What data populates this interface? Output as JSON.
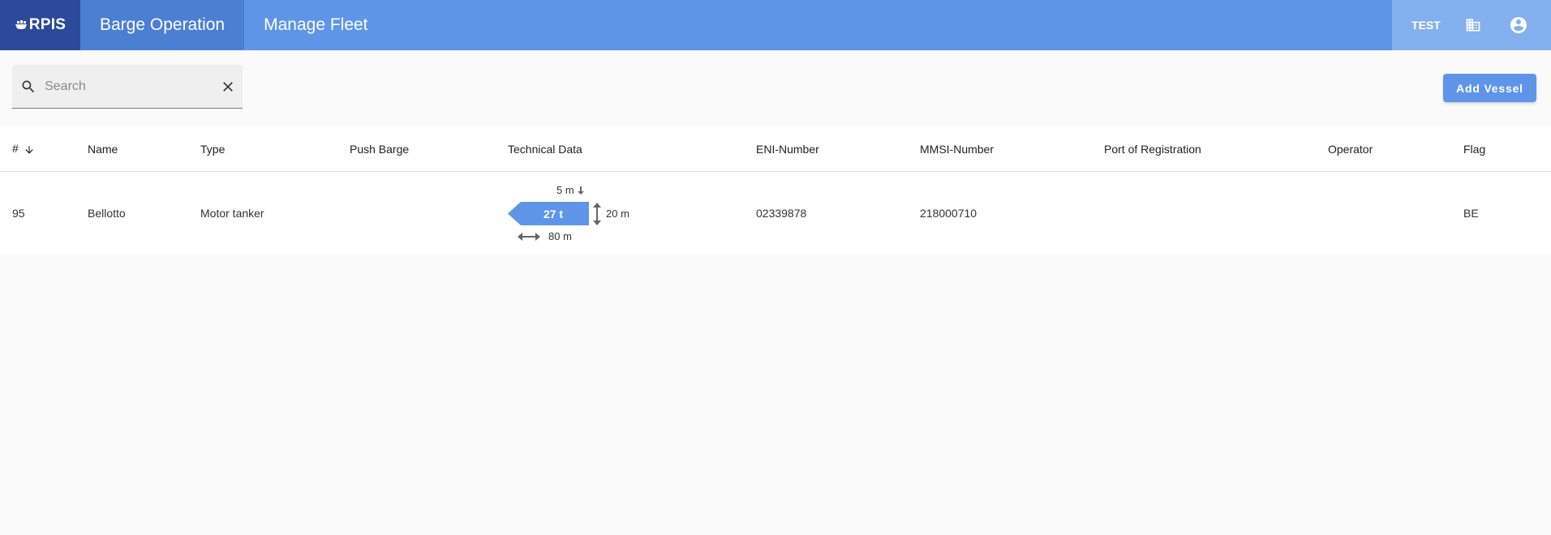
{
  "header": {
    "logo_text": "RPIS",
    "tabs": [
      {
        "label": "Barge Operation",
        "active": true
      },
      {
        "label": "Manage Fleet",
        "active": false
      }
    ],
    "org_label": "TEST",
    "icons": [
      "building-icon",
      "account-circle-icon"
    ]
  },
  "search": {
    "placeholder": "Search",
    "value": ""
  },
  "toolbar": {
    "add_label": "Add Vessel"
  },
  "table": {
    "columns": [
      "#",
      "Name",
      "Type",
      "Push Barge",
      "Technical Data",
      "ENI-Number",
      "MMSI-Number",
      "Port of Registration",
      "Operator",
      "Flag"
    ],
    "rows": [
      {
        "num": "95",
        "name": "Bellotto",
        "type": "Motor tanker",
        "push_barge": "",
        "tech": {
          "draft": "5 m",
          "tonnage": "27 t",
          "width": "20 m",
          "length": "80 m"
        },
        "eni": "02339878",
        "mmsi": "218000710",
        "port": "",
        "operator": "",
        "flag": "BE"
      }
    ]
  },
  "colors": {
    "brand": "#5e95e8",
    "brand_dark": "#2c4a99",
    "tab_active": "#4a7fd4",
    "header_right": "#85b0ef"
  }
}
